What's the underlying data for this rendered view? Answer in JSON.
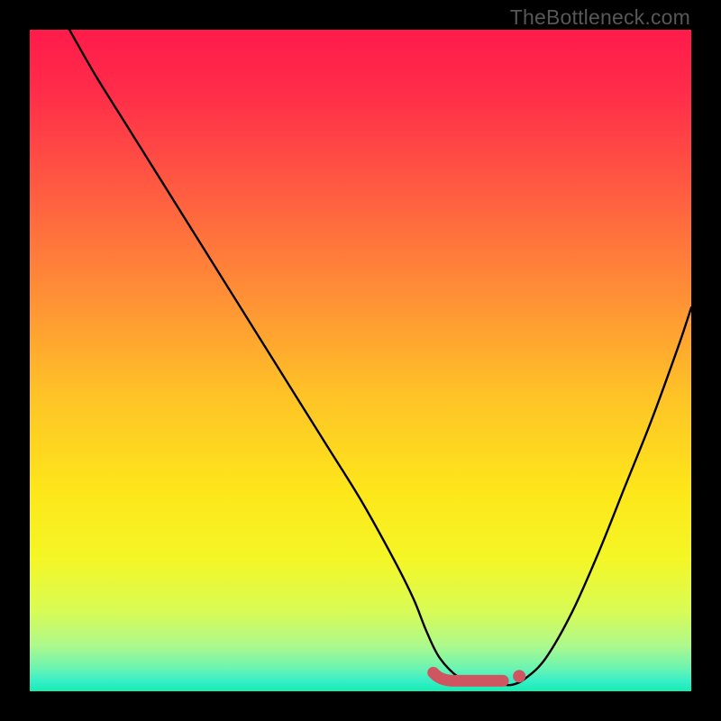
{
  "watermark": {
    "text": "TheBottleneck.com"
  },
  "chart_data": {
    "type": "line",
    "title": "",
    "xlabel": "",
    "ylabel": "",
    "xlim": [
      0,
      100
    ],
    "ylim": [
      0,
      100
    ],
    "grid": false,
    "series": [
      {
        "name": "bottleneck-curve",
        "x": [
          6,
          10,
          15,
          20,
          25,
          30,
          35,
          40,
          45,
          50,
          55,
          58,
          60,
          62,
          65,
          68,
          71,
          73,
          75,
          78,
          82,
          86,
          90,
          94,
          98,
          100
        ],
        "y": [
          100,
          93,
          85,
          77,
          69,
          61,
          53,
          45,
          37,
          29,
          20,
          14,
          9,
          5,
          2,
          1,
          1,
          1,
          2,
          5,
          12,
          21,
          31,
          41,
          52,
          58
        ]
      }
    ],
    "annotations": [
      {
        "name": "valley-marker",
        "x_range": [
          61,
          74
        ],
        "y": 2,
        "color": "#cf5661"
      }
    ],
    "background_gradient": {
      "stops": [
        {
          "offset": 0.0,
          "color": "#ff1b4a"
        },
        {
          "offset": 0.1,
          "color": "#ff2e49"
        },
        {
          "offset": 0.25,
          "color": "#ff5e41"
        },
        {
          "offset": 0.4,
          "color": "#ff8f36"
        },
        {
          "offset": 0.55,
          "color": "#ffc227"
        },
        {
          "offset": 0.7,
          "color": "#fde71a"
        },
        {
          "offset": 0.8,
          "color": "#f4f626"
        },
        {
          "offset": 0.88,
          "color": "#d8fb56"
        },
        {
          "offset": 0.93,
          "color": "#aef98b"
        },
        {
          "offset": 0.965,
          "color": "#6cf4b2"
        },
        {
          "offset": 0.985,
          "color": "#35efc8"
        },
        {
          "offset": 1.0,
          "color": "#16edb0"
        }
      ]
    }
  }
}
